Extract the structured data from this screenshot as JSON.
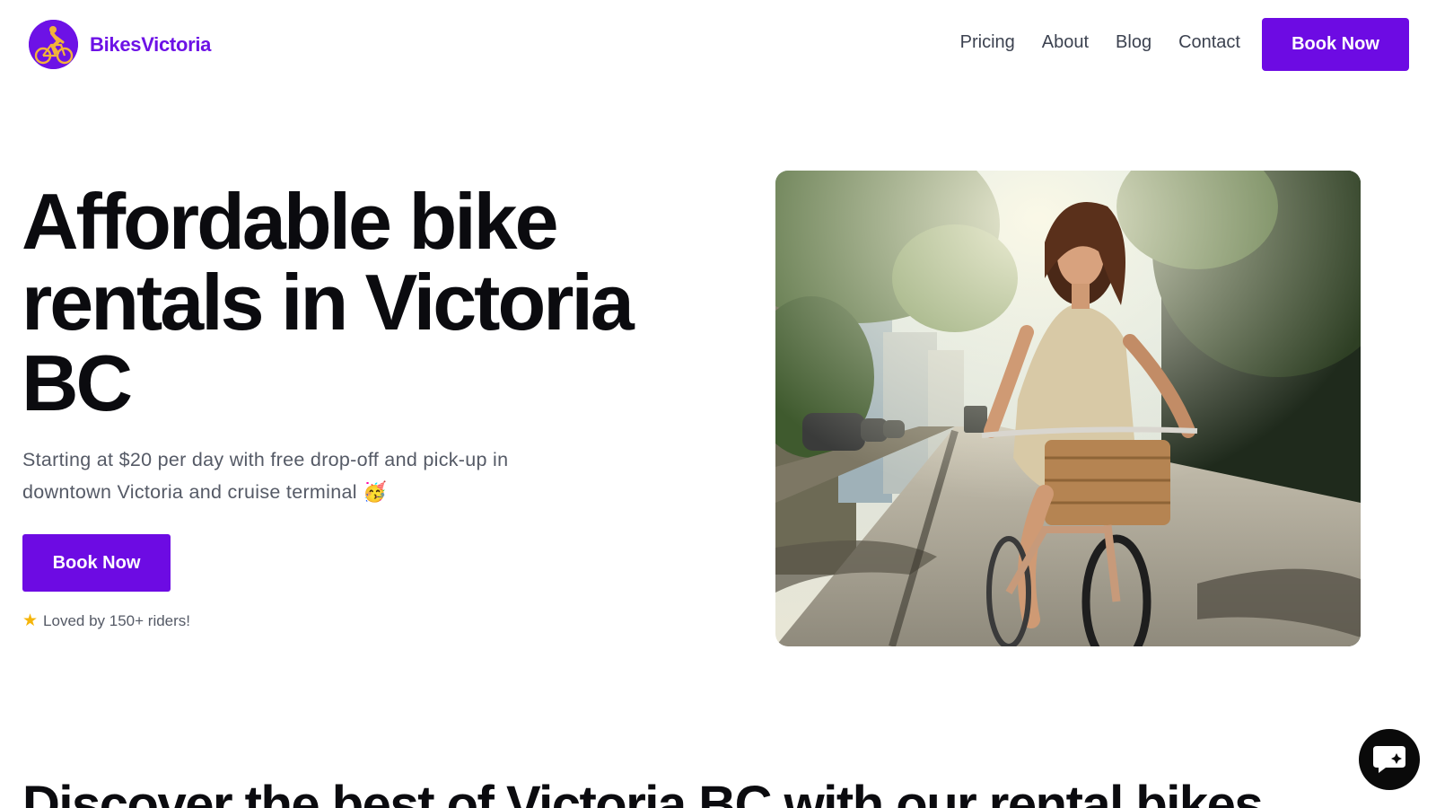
{
  "header": {
    "brand": "BikesVictoria",
    "logo_icon": "cyclist-icon",
    "nav": [
      {
        "label": "Pricing"
      },
      {
        "label": "About"
      },
      {
        "label": "Blog"
      },
      {
        "label": "Contact"
      }
    ],
    "cta_label": "Book Now"
  },
  "hero": {
    "title": "Affordable bike rentals in Victoria BC",
    "subtitle": "Starting at $20 per day with free drop-off and pick-up in downtown Victoria and cruise terminal 🥳",
    "cta_label": "Book Now",
    "social_proof_icon": "star-icon",
    "social_proof": "Loved by 150+ riders!",
    "photo_alt": "woman-riding-bicycle-photo"
  },
  "section": {
    "title": "Discover the best of Victoria BC with our rental bikes"
  },
  "chat": {
    "icon": "chat-bubble-icon"
  },
  "colors": {
    "brand": "#6d0be3",
    "text": "#0b0b0f",
    "muted": "#555a66",
    "star": "#f5b50a"
  }
}
